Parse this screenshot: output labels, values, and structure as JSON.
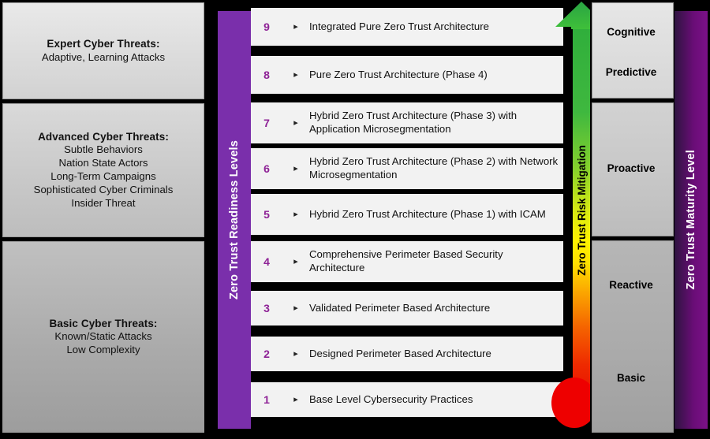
{
  "threat_panel": {
    "bands": [
      {
        "id": "expert",
        "title": "Expert Cyber Threats:",
        "lines": [
          "Adaptive,  Learning Attacks"
        ]
      },
      {
        "id": "advanced",
        "title": "Advanced Cyber Threats:",
        "lines": [
          "Subtle Behaviors",
          "Nation State Actors",
          "Long-Term Campaigns",
          "Sophisticated Cyber Criminals",
          "Insider Threat"
        ]
      },
      {
        "id": "basic",
        "title": "Basic Cyber Threats:",
        "lines": [
          "Known/Static Attacks",
          "Low Complexity"
        ]
      }
    ]
  },
  "readiness_axis": {
    "label": "Zero Trust Readiness Levels",
    "color": "#7a2fab"
  },
  "maturity_axis": {
    "label": "Zero Trust Maturity Level",
    "color": "#6a0d77"
  },
  "thermometer": {
    "label": "Zero Trust Risk Mitigation",
    "top_color": "#2fae3b",
    "mid_color": "#fff200",
    "bottom_color": "#e81000",
    "arrow": "up-arrow",
    "bulb": "thermometer-bulb"
  },
  "levels": [
    {
      "number": "9",
      "bullet": "▸",
      "text": "Integrated  Pure Zero Trust Architecture"
    },
    {
      "number": "8",
      "bullet": "▸",
      "text": "Pure Zero Trust Architecture (Phase 4)"
    },
    {
      "number": "7",
      "bullet": "▸",
      "text": "Hybrid Zero Trust Architecture (Phase 3) with Application Microsegmentation"
    },
    {
      "number": "6",
      "bullet": "▸",
      "text": "Hybrid Zero Trust Architecture (Phase 2) with Network Microsegmentation"
    },
    {
      "number": "5",
      "bullet": "▸",
      "text": "Hybrid Zero Trust Architecture (Phase 1) with ICAM"
    },
    {
      "number": "4",
      "bullet": "▸",
      "text": "Comprehensive Perimeter Based Security Architecture"
    },
    {
      "number": "3",
      "bullet": "▸",
      "text": "Validated  Perimeter Based Architecture"
    },
    {
      "number": "2",
      "bullet": "▸",
      "text": "Designed Perimeter Based Architecture"
    },
    {
      "number": "1",
      "bullet": "▸",
      "text": "Base Level Cybersecurity Practices"
    }
  ],
  "maturity_stages": [
    {
      "label": "Cognitive"
    },
    {
      "label": "Predictive"
    },
    {
      "label": "Proactive"
    },
    {
      "label": "Reactive"
    },
    {
      "label": "Basic"
    }
  ]
}
